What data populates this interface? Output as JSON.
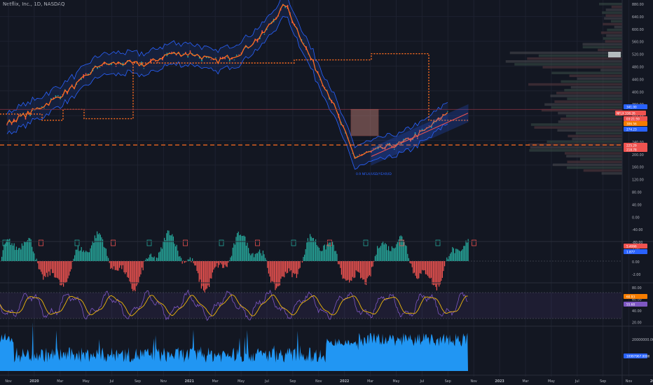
{
  "header": {
    "symbol_title": "Netflix, Inc., 1D, NASDAQ"
  },
  "colors": {
    "background": "#131722",
    "price_line": "#ff6d1f",
    "band": "#2962ff",
    "histogram_up": "#26a69a",
    "histogram_down": "#ef5350",
    "oscillator": "#7e57c2",
    "signal": "#f0b90b",
    "volume": "#2196f3"
  },
  "annotations": {
    "lower_band_label": "0.9 NFLX/USD/YEAR/ID"
  },
  "chart_data": [
    {
      "type": "line",
      "pane": "price",
      "title": "",
      "y_axis_labels": [
        "880.00",
        "640.00",
        "600.00",
        "560.00",
        "520.00",
        "480.00",
        "440.00",
        "400.00",
        "360.00",
        "320.00",
        "280.00",
        "240.00",
        "200.00",
        "160.00",
        "120.00",
        "80.00",
        "40.00",
        "0.00",
        "-40.00",
        "-80.00"
      ],
      "price_tags": [
        {
          "label": "NFLX",
          "value": "338.26",
          "color": "#ef5350"
        },
        {
          "label": "",
          "value": "341.00",
          "color": "#2962ff"
        },
        {
          "label": "",
          "value": "03:21:59",
          "color": "#ef5350"
        },
        {
          "label": "",
          "value": "306.56",
          "color": "#f57c00"
        },
        {
          "label": "",
          "value": "274.23",
          "color": "#2962ff"
        },
        {
          "label": "",
          "value": "225.29",
          "color": "#ef5350"
        },
        {
          "label": "",
          "value": "218.78",
          "color": "#ef5350"
        }
      ],
      "series": [
        {
          "x": [
            "2019-11",
            "2020-01",
            "2020-03",
            "2020-05",
            "2020-07",
            "2020-09",
            "2020-11",
            "2021-01",
            "2021-03",
            "2021-05",
            "2021-07",
            "2021-09",
            "2021-11",
            "2022-01",
            "2022-03",
            "2022-05",
            "2022-07",
            "2022-09",
            "2022-11",
            "2023-01"
          ],
          "values": [
            295,
            330,
            370,
            420,
            485,
            490,
            485,
            520,
            520,
            495,
            520,
            580,
            680,
            520,
            370,
            185,
            210,
            230,
            270,
            330
          ]
        }
      ],
      "support_levels": [
        530,
        325,
        305,
        225
      ]
    },
    {
      "type": "bar",
      "pane": "histogram",
      "y_axis_labels": [
        "2.00",
        "0.00",
        "-2.00"
      ],
      "price_tags": [
        {
          "value": "5.4066",
          "color": "#ef5350"
        },
        {
          "value": "1.877",
          "color": "#2962ff"
        }
      ]
    },
    {
      "type": "line",
      "pane": "oscillator",
      "y_axis_labels": [
        "80.00",
        "60.00",
        "40.00",
        "20.00"
      ],
      "price_tags": [
        {
          "value": "60.93",
          "color": "#f57c00"
        },
        {
          "value": "55.68",
          "color": "#7e57c2"
        }
      ]
    },
    {
      "type": "area",
      "pane": "volume",
      "y_axis_labels": [
        "20000000.00"
      ],
      "price_tags": [
        {
          "value": "10997967.0000",
          "color": "#2962ff"
        }
      ]
    },
    {
      "type": "axis",
      "x_tick_labels": [
        "Nov",
        "2020",
        "Mar",
        "May",
        "Jul",
        "Sep",
        "Nov",
        "2021",
        "Mar",
        "May",
        "Jul",
        "Sep",
        "Nov",
        "2022",
        "Mar",
        "May",
        "Jul",
        "Sep",
        "Nov",
        "2023",
        "Mar",
        "May",
        "Jul",
        "Sep",
        "Nov",
        "2024",
        "Mar"
      ]
    }
  ]
}
